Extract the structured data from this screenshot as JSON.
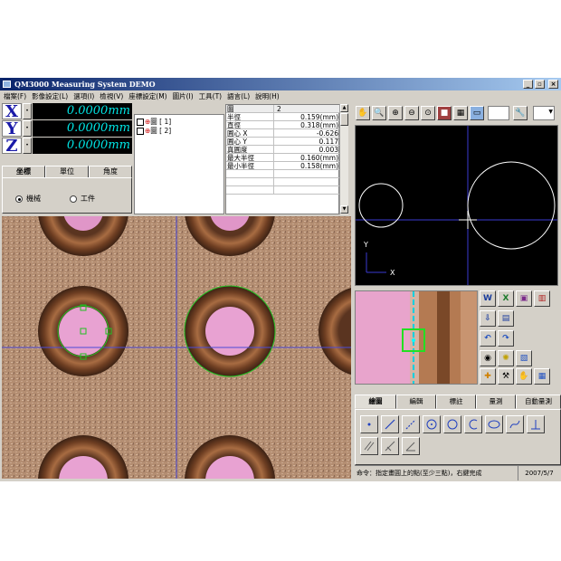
{
  "window": {
    "title": "QM3000 Measuring System DEMO"
  },
  "menu": [
    "檔案(F)",
    "影像設定(L)",
    "選項(I)",
    "檢視(V)",
    "座標設定(M)",
    "圖片(I)",
    "工具(T)",
    "語言(L)",
    "說明(H)"
  ],
  "dro": {
    "x_label": "X",
    "x_value": "0.0000mm",
    "y_label": "Y",
    "y_value": "0.0000mm",
    "z_label": "Z",
    "z_value": "0.0000mm"
  },
  "coord_tabs": [
    "坐標",
    "單位",
    "角度"
  ],
  "coord_options": {
    "machine": "機械",
    "workpiece": "工件",
    "selected": "machine"
  },
  "tree": [
    "圖 [ 1]",
    "圖 [ 2]"
  ],
  "props": {
    "header": {
      "name": "圖",
      "value": "2"
    },
    "rows": [
      {
        "name": "半徑",
        "value": "0.159(mm)"
      },
      {
        "name": "直徑",
        "value": "0.318(mm)"
      },
      {
        "name": "圓心 X",
        "value": "-0.626"
      },
      {
        "name": "圓心 Y",
        "value": "0.117"
      },
      {
        "name": "真圓度",
        "value": "0.003"
      },
      {
        "name": "最大半徑",
        "value": "0.160(mm)"
      },
      {
        "name": "最小半徑",
        "value": "0.158(mm)"
      }
    ]
  },
  "preview": {
    "axis_y": "Y",
    "axis_x": "X"
  },
  "bottom_tabs": [
    "繪圖",
    "編輯",
    "標註",
    "量測",
    "自動量測"
  ],
  "status": {
    "command": "命令：指定畫圓上的點(至少三點)，右鍵完成",
    "date": "2007/5/7"
  },
  "colors": {
    "dro_background": "#000000",
    "dro_text": "#00e5e5",
    "axis_letter": "#1a1aa8",
    "title_start": "#0a246a",
    "fit_circle": "#22c022"
  }
}
